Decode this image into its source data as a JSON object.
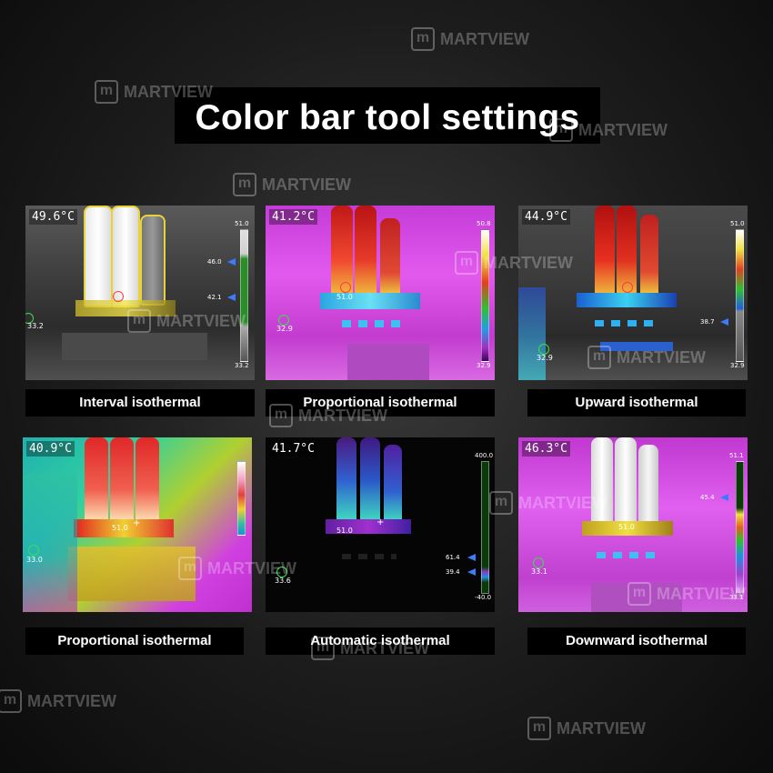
{
  "title": "Color bar tool settings",
  "watermark": "MARTVIEW",
  "watermark_logo": "m",
  "panels": [
    {
      "temp": "49.6°C",
      "caption": "Interval isothermal",
      "bar_top": "51.0",
      "bar_bottom": "33.2",
      "markers": [
        "46.0",
        "42.1"
      ],
      "point_label": "33.2",
      "spot_label": ""
    },
    {
      "temp": "41.2°C",
      "caption": "Proportional isothermal",
      "bar_top": "50.8",
      "bar_bottom": "32.9",
      "markers": [],
      "point_label": "32.9",
      "spot_label": "51.0"
    },
    {
      "temp": "44.9°C",
      "caption": "Upward isothermal",
      "bar_top": "51.0",
      "bar_bottom": "32.9",
      "markers": [
        "38.7"
      ],
      "point_label": "32.9",
      "spot_label": ""
    },
    {
      "temp": "40.9°C",
      "caption": "Proportional isothermal",
      "bar_top": "",
      "bar_bottom": "",
      "markers": [],
      "point_label": "33.0",
      "spot_label": "51.0"
    },
    {
      "temp": "41.7°C",
      "caption": "Automatic isothermal",
      "bar_top": "400.0",
      "bar_bottom": "-40.0",
      "markers": [
        "61.4",
        "39.4"
      ],
      "point_label": "33.6",
      "spot_label": "51.0"
    },
    {
      "temp": "46.3°C",
      "caption": "Downward isothermal",
      "bar_top": "51.1",
      "bar_bottom": "33.1",
      "markers": [
        "45.4"
      ],
      "point_label": "33.1",
      "spot_label": "51.0"
    }
  ]
}
